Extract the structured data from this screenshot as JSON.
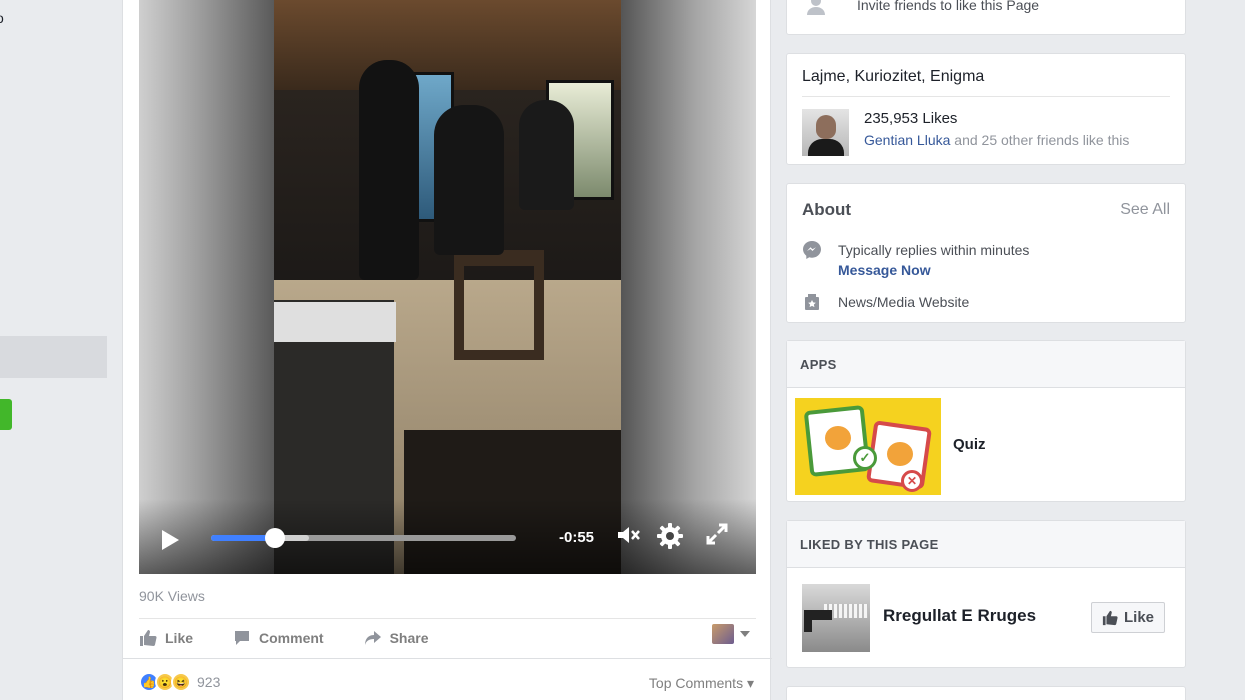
{
  "left_sidebar": {
    "stub_text": "o"
  },
  "video": {
    "time_remaining": "-0:55",
    "progress_fraction": 0.21,
    "buffered_fraction": 0.32,
    "play_icon": "play-icon",
    "mute_icon": "mute-icon",
    "settings_icon": "gear-icon",
    "fullscreen_icon": "fullscreen-icon"
  },
  "post": {
    "views": "90K Views",
    "actions": {
      "like": "Like",
      "comment": "Comment",
      "share": "Share"
    },
    "reaction_count": "923",
    "top_comments": "Top Comments"
  },
  "sidebar": {
    "invite_text": "Invite friends to like this Page",
    "categories": "Lajme, Kuriozitet, Enigma",
    "likes_count": "235,953 Likes",
    "friend_name": "Gentian Lluka",
    "friends_like_suffix": " and 25 other friends like this",
    "about": {
      "title": "About",
      "see_all": "See All",
      "replies": "Typically replies within minutes",
      "message_now": "Message Now",
      "category": "News/Media Website"
    },
    "apps": {
      "header": "APPS",
      "app_name": "Quiz"
    },
    "liked_by_page": {
      "header": "LIKED BY THIS PAGE",
      "page_name": "Rregullat E Rruges",
      "like_button": "Like"
    }
  },
  "colors": {
    "accent_blue": "#4080ff",
    "link_blue": "#365899",
    "green": "#42b72a",
    "page_bg": "#e9ebee"
  }
}
